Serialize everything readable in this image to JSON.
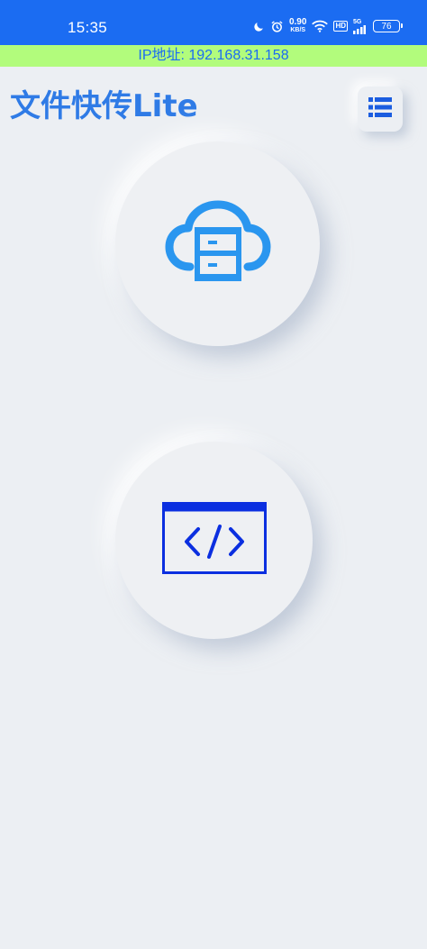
{
  "status_bar": {
    "time": "15:35",
    "net_speed_value": "0.90",
    "net_speed_unit": "KB/S",
    "hd_label": "HD",
    "network_label": "5G",
    "battery_level": "76",
    "background_color": "#1b6cf2"
  },
  "ip_banner": {
    "text": "IP地址: 192.168.31.158",
    "background_color": "#b2fc7c",
    "text_color": "#1b6cf2"
  },
  "header": {
    "title": "文件快传Lite",
    "title_color": "#2f7be6",
    "menu_icon": "list-icon"
  },
  "actions": [
    {
      "icon": "cloud-server-icon",
      "icon_color": "#2a96ef"
    },
    {
      "icon": "code-window-icon",
      "icon_color": "#0b2fe0"
    }
  ]
}
